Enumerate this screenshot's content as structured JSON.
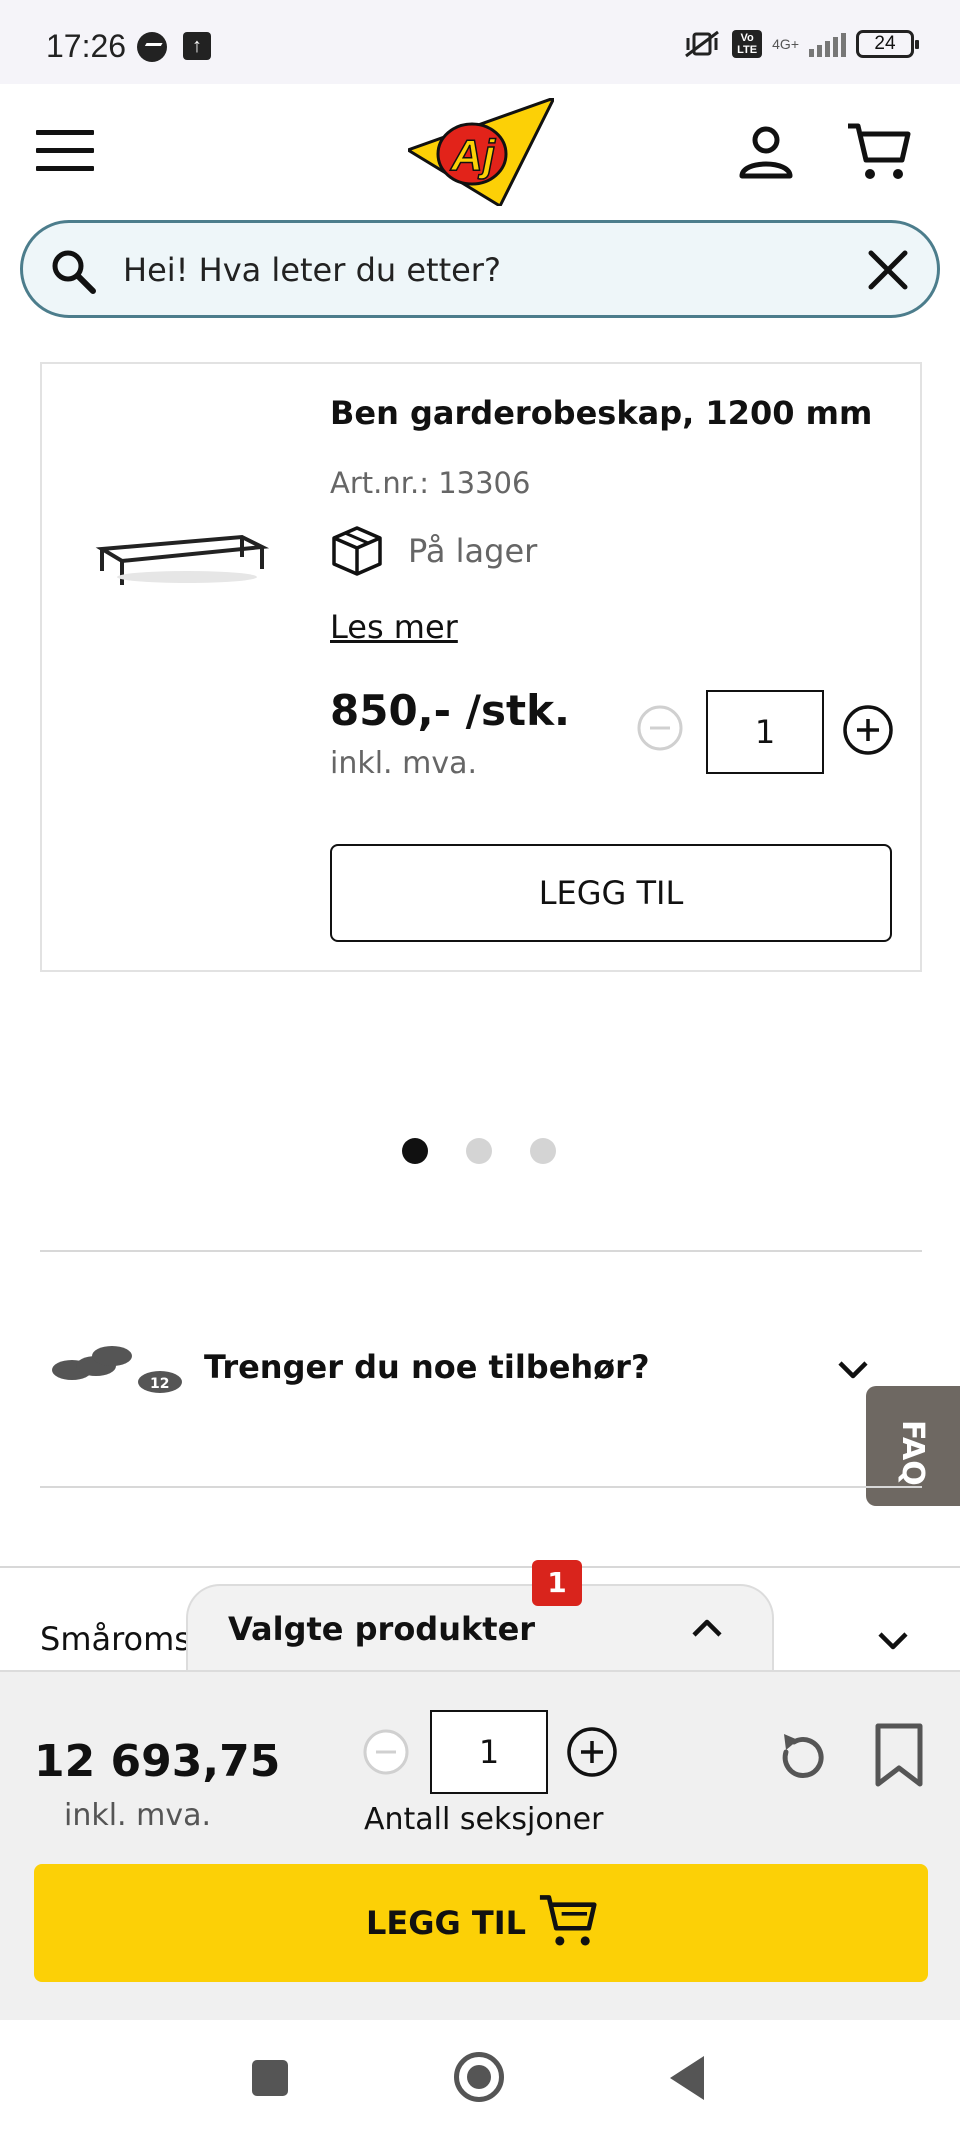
{
  "status_bar": {
    "time": "17:26",
    "network": "4G+",
    "volte": "Vo LTE",
    "battery": "24"
  },
  "header": {
    "logo_text": "Aj",
    "menu_icon": "hamburger-menu-icon",
    "user_icon": "user-icon",
    "cart_icon": "cart-icon"
  },
  "search": {
    "placeholder": "Hei! Hva leter du etter?"
  },
  "product": {
    "title": "Ben garderobeskap, 1200 mm",
    "art_nr": "Art.nr.: 13306",
    "stock": "På lager",
    "read_more": "Les mer",
    "price": "850,-  /stk.",
    "vat": "inkl. mva.",
    "quantity": "1",
    "add_label": "LEGG TIL"
  },
  "carousel": {
    "total_dots": 3,
    "active_dot": 1
  },
  "accessories": {
    "title": "Trenger du noe tilbehør?",
    "tag_number": "12"
  },
  "faq": {
    "label": "FAQ"
  },
  "small_section": {
    "label": "Småroms"
  },
  "selected_products": {
    "label": "Valgte produkter",
    "badge_count": "1"
  },
  "bottom_bar": {
    "total": "12 693,75",
    "vat": "inkl. mva.",
    "sections_quantity": "1",
    "sections_label": "Antall seksjoner",
    "add_label": "LEGG TIL"
  },
  "colors": {
    "accent_yellow": "#fcd006",
    "badge_red": "#d9241c",
    "search_border": "#4c7d8c",
    "faq_bg": "#6e6862"
  }
}
